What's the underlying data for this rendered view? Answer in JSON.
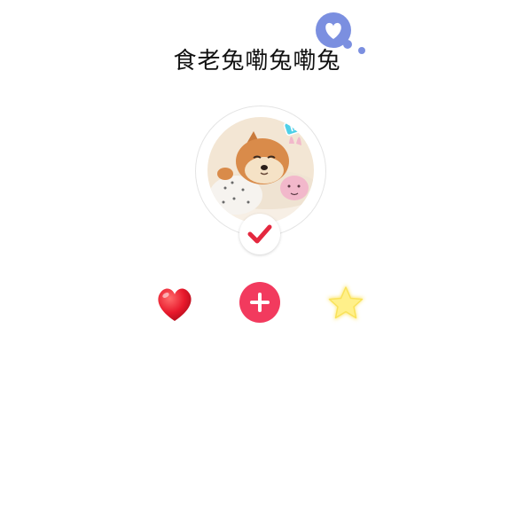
{
  "profile": {
    "nickname": "食老兔嘞兔嘞兔",
    "avatar_sticker_text": "ISTJ",
    "verified": true
  },
  "icons": {
    "title_decoration": "heart-speech-bubble-icon",
    "verify": "checkmark-icon",
    "like": "heart-icon",
    "follow": "plus-icon",
    "favorite": "star-icon"
  },
  "colors": {
    "accent_blue": "#7b8fe0",
    "check_red": "#e4283f",
    "follow_pink": "#f23a5e",
    "heart_red": "#e8192c",
    "star_yellow": "#fde66a",
    "sticker_cyan": "#4fd0e8"
  }
}
